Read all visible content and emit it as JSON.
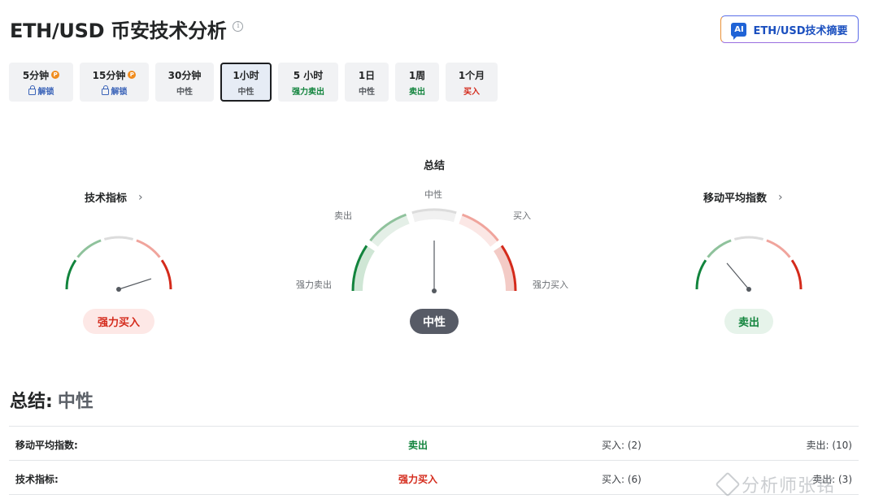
{
  "header": {
    "title": "ETH/USD 币安技术分析",
    "ai_button_badge": "AI",
    "ai_button_label": "ETH/USD技术摘要"
  },
  "tabs": [
    {
      "label": "5分钟",
      "sub": "解锁",
      "locked": true
    },
    {
      "label": "15分钟",
      "sub": "解锁",
      "locked": true
    },
    {
      "label": "30分钟",
      "sub": "中性"
    },
    {
      "label": "1小时",
      "sub": "中性",
      "active": true
    },
    {
      "label": "5 小时",
      "sub": "强力卖出"
    },
    {
      "label": "1日",
      "sub": "中性"
    },
    {
      "label": "1周",
      "sub": "卖出"
    },
    {
      "label": "1个月",
      "sub": "买入"
    }
  ],
  "gauges": {
    "technical": {
      "title": "技术指标",
      "verdict": "强力买入",
      "needle_level": "强力买入"
    },
    "summary": {
      "title": "总结",
      "verdict": "中性",
      "needle_level": "中性",
      "labels": {
        "strong_sell": "强力卖出",
        "sell": "卖出",
        "neutral": "中性",
        "buy": "买入",
        "strong_buy": "强力买入"
      }
    },
    "moving_averages": {
      "title": "移动平均指数",
      "verdict": "卖出",
      "needle_level": "卖出"
    }
  },
  "summary": {
    "heading": "总结:",
    "verdict": "中性",
    "rows": [
      {
        "name": "移动平均指数:",
        "verdict": "卖出",
        "buy": "买入: (2)",
        "sell": "卖出: (10)"
      },
      {
        "name": "技术指标:",
        "verdict": "强力买入",
        "buy": "买入: (6)",
        "sell": "卖出: (3)"
      }
    ]
  },
  "watermark": "分析师张铭",
  "colors": {
    "strong_sell": "#12843d",
    "sell": "#8fc29c",
    "neutral": "#dcdcdc",
    "buy": "#f0a49c",
    "strong_buy": "#d42a1b"
  }
}
